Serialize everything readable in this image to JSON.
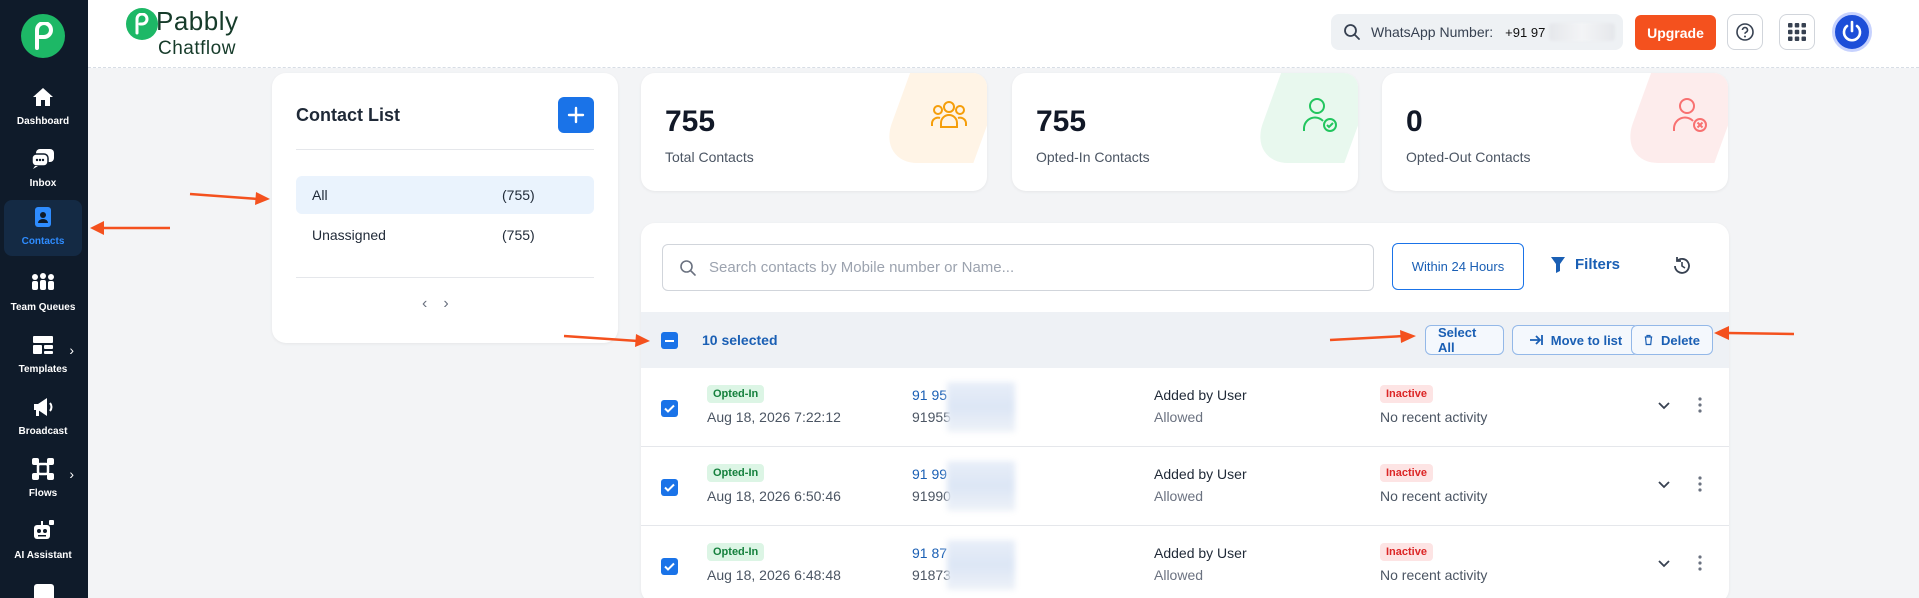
{
  "sidebar": {
    "items": [
      {
        "label": "Dashboard",
        "icon": "home-icon"
      },
      {
        "label": "Inbox",
        "icon": "chat-icon"
      },
      {
        "label": "Contacts",
        "icon": "contacts-icon",
        "active": true
      },
      {
        "label": "Team Queues",
        "icon": "team-icon"
      },
      {
        "label": "Templates",
        "icon": "templates-icon"
      },
      {
        "label": "Broadcast",
        "icon": "megaphone-icon"
      },
      {
        "label": "Flows",
        "icon": "flows-icon"
      },
      {
        "label": "AI Assistant",
        "icon": "robot-icon"
      }
    ]
  },
  "header": {
    "brand_top": "Pabbly",
    "brand_bottom": "Chatflow",
    "whatsapp_label": "WhatsApp Number:",
    "whatsapp_number": "+91 97",
    "upgrade_label": "Upgrade"
  },
  "contact_list": {
    "title": "Contact List",
    "items": [
      {
        "label": "All",
        "count": "(755)"
      },
      {
        "label": "Unassigned",
        "count": "(755)"
      }
    ]
  },
  "stats": [
    {
      "value": "755",
      "label": "Total Contacts",
      "color": "#f59e0b"
    },
    {
      "value": "755",
      "label": "Opted-In Contacts",
      "color": "#22c55e"
    },
    {
      "value": "0",
      "label": "Opted-Out Contacts",
      "color": "#f87171"
    }
  ],
  "table": {
    "search_placeholder": "Search contacts by Mobile number or Name...",
    "within_label": "Within 24 Hours",
    "filters_label": "Filters",
    "selected_text": "10 selected",
    "select_all_label": "Select All",
    "move_label": "Move to list",
    "delete_label": "Delete",
    "rows": [
      {
        "status": "Opted-In",
        "date": "Aug 18, 2026 7:22:12",
        "phone_primary": "91 95",
        "phone_secondary": "91955",
        "source": "Added by User",
        "permission": "Allowed",
        "activity_badge": "Inactive",
        "activity": "No recent activity"
      },
      {
        "status": "Opted-In",
        "date": "Aug 18, 2026 6:50:46",
        "phone_primary": "91 99",
        "phone_secondary": "91990",
        "source": "Added by User",
        "permission": "Allowed",
        "activity_badge": "Inactive",
        "activity": "No recent activity"
      },
      {
        "status": "Opted-In",
        "date": "Aug 18, 2026 6:48:48",
        "phone_primary": "91 87",
        "phone_secondary": "91873",
        "source": "Added by User",
        "permission": "Allowed",
        "activity_badge": "Inactive",
        "activity": "No recent activity"
      }
    ]
  },
  "colors": {
    "accent": "#1a73e8",
    "brand": "#1db866",
    "upgrade": "#f4511e",
    "annotation": "#f4511e"
  }
}
